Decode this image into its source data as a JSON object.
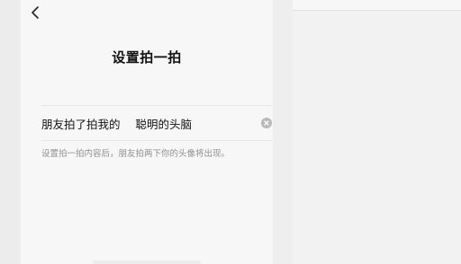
{
  "header": {
    "back_icon": "chevron-left-icon",
    "title": "设置拍一拍"
  },
  "form": {
    "prefix_label": "朋友拍了拍我的",
    "input_value": "聪明的头脑",
    "clear_icon": "clear-circle-icon",
    "hint": "设置拍一拍内容后，朋友拍两下你的头像将出现。"
  }
}
